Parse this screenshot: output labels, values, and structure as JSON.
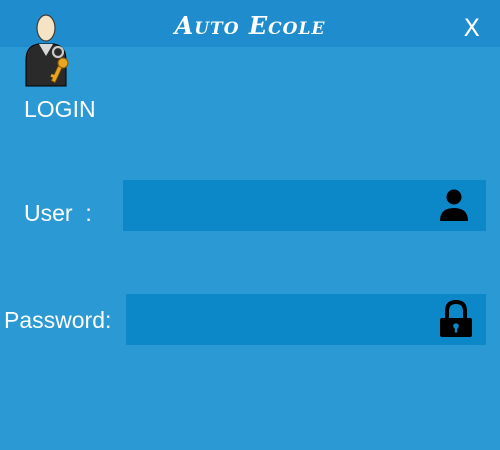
{
  "window": {
    "title": "Auto Ecole",
    "close_label": "X"
  },
  "login": {
    "heading": "LOGIN",
    "user_label": "User  :",
    "user_value": "",
    "password_label": "Password:",
    "password_value": ""
  },
  "icons": {
    "logo": "user-with-key-icon",
    "user": "person-icon",
    "password": "padlock-icon"
  },
  "colors": {
    "background": "#2b99d4",
    "titlebar": "#1f8dcd",
    "field": "#0c88c9",
    "text": "#ffffff"
  }
}
